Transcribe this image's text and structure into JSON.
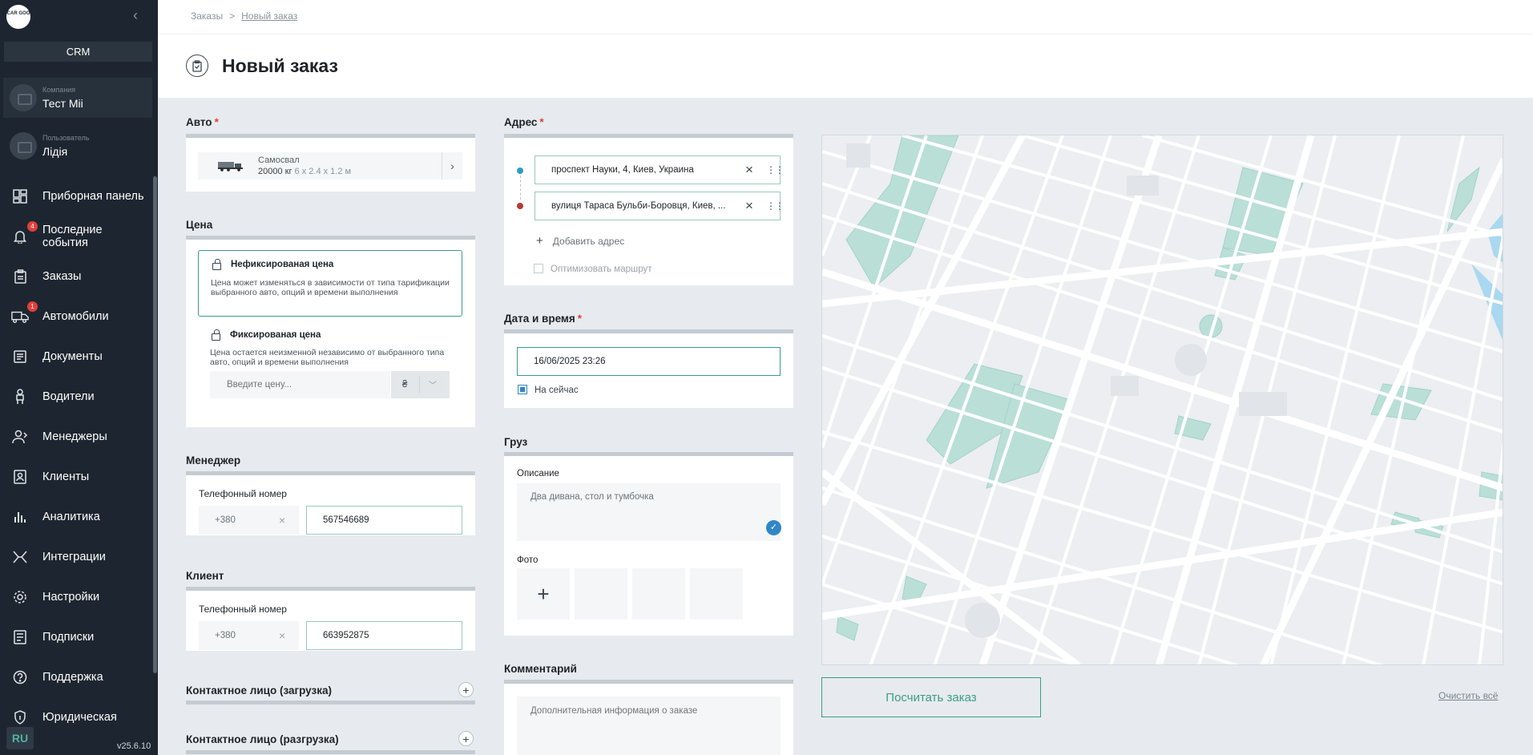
{
  "sidebar": {
    "logo_text": "CAR GOO",
    "crm_label": "CRM",
    "company": {
      "label": "Компания",
      "value": "Тест Mii"
    },
    "user": {
      "label": "Пользователь",
      "value": "Лідія"
    },
    "items": [
      {
        "label": "Приборная панель",
        "icon": "dashboard-icon"
      },
      {
        "label": "Последние события",
        "icon": "bell-icon",
        "badge": "4"
      },
      {
        "label": "Заказы",
        "icon": "clipboard-icon"
      },
      {
        "label": "Автомобили",
        "icon": "truck-icon",
        "badge": "1"
      },
      {
        "label": "Документы",
        "icon": "documents-icon"
      },
      {
        "label": "Водители",
        "icon": "driver-icon"
      },
      {
        "label": "Менеджеры",
        "icon": "managers-icon"
      },
      {
        "label": "Клиенты",
        "icon": "clients-icon"
      },
      {
        "label": "Аналитика",
        "icon": "analytics-icon"
      },
      {
        "label": "Интеграции",
        "icon": "integrations-icon"
      },
      {
        "label": "Настройки",
        "icon": "gear-icon"
      },
      {
        "label": "Подписки",
        "icon": "subscriptions-icon"
      },
      {
        "label": "Поддержка",
        "icon": "help-icon"
      },
      {
        "label": "Юридическая",
        "icon": "shield-icon"
      }
    ],
    "language": "RU",
    "version": "v25.6.10"
  },
  "breadcrumb": {
    "parent": "Заказы",
    "separator": ">",
    "current": "Новый заказ"
  },
  "page_title": "Новый заказ",
  "auto": {
    "heading": "Авто",
    "vehicle_name": "Самосвал",
    "vehicle_capacity": "20000 кг",
    "vehicle_dims": "6 x 2.4 x 1.2 м"
  },
  "price": {
    "heading": "Цена",
    "unfixed_title": "Нефиксированая цена",
    "unfixed_desc": "Цена может изменяться в зависимости от типа тарификации выбранного авто, опций и времени выполнения",
    "fixed_title": "Фиксированая цена",
    "fixed_desc": "Цена остается неизменной независимо от выбранного типа авто, опций и времени выполнения",
    "input_placeholder": "Введите цену...",
    "currency": "₴"
  },
  "manager": {
    "heading": "Менеджер",
    "phone_label": "Телефонный номер",
    "code": "+380",
    "number": "567546689"
  },
  "client": {
    "heading": "Клиент",
    "phone_label": "Телефонный номер",
    "code": "+380",
    "number": "663952875"
  },
  "contact_load": {
    "heading": "Контактное лицо (загрузка)"
  },
  "contact_unload": {
    "heading": "Контактное лицо (разгрузка)"
  },
  "address": {
    "heading": "Адрес",
    "from": "проспект Науки, 4, Киев, Украина",
    "to": "вулиця Тараса Бульби-Боровця, Киев, ...",
    "add_label": "Добавить адрес",
    "optimize_label": "Оптимизовать маршрут",
    "from_color": "#2f9cc6",
    "to_color": "#b43a36"
  },
  "datetime": {
    "heading": "Дата и время",
    "value": "16/06/2025 23:26",
    "now_label": "На сейчас"
  },
  "cargo": {
    "heading": "Груз",
    "description_label": "Описание",
    "description_value": "Два дивана, стол и тумбочка",
    "photo_label": "Фото"
  },
  "comment": {
    "heading": "Комментарий",
    "placeholder": "Дополнительная информация о заказе"
  },
  "actions": {
    "calculate": "Посчитать заказ",
    "clear": "Очистить всё"
  },
  "colors": {
    "accent": "#3a9d86",
    "sidebar": "#1d2630",
    "badge": "#e0403a"
  }
}
